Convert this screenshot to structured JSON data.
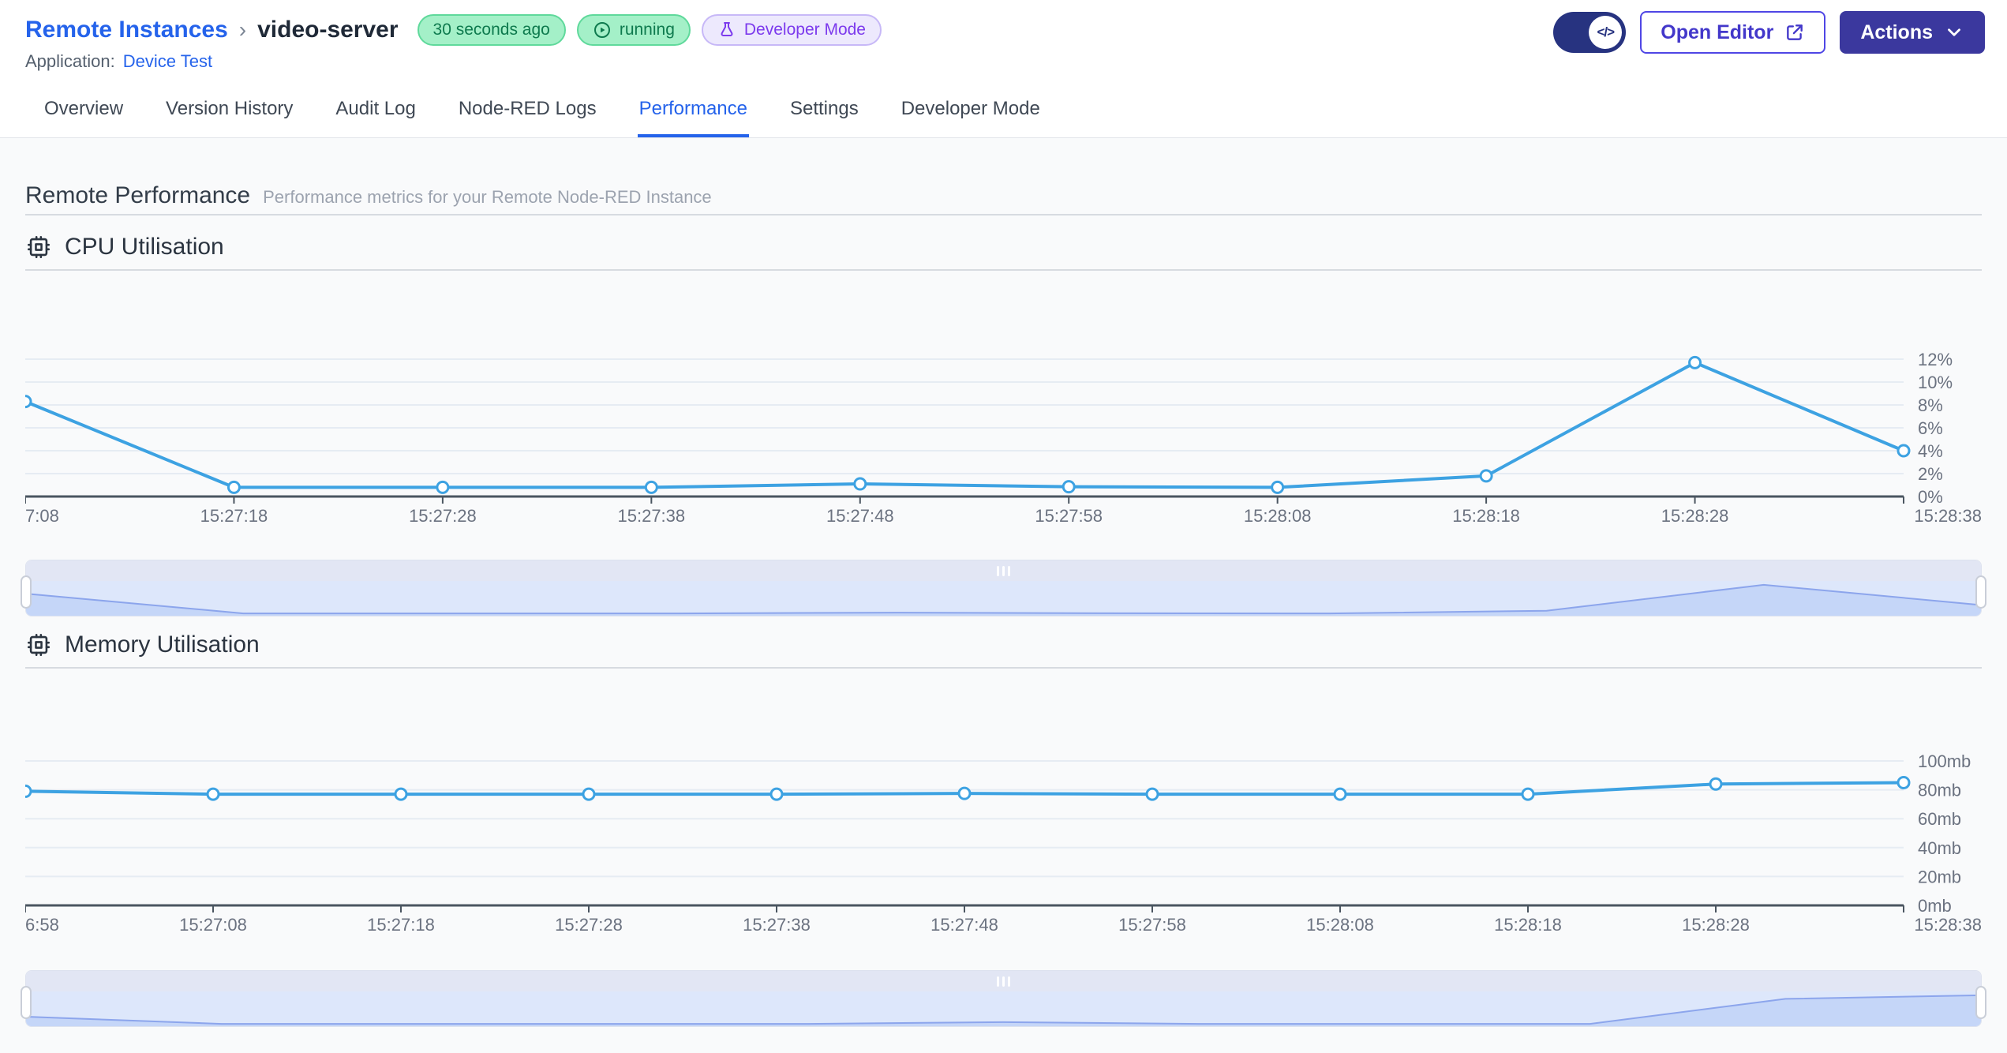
{
  "header": {
    "breadcrumb": {
      "root": "Remote Instances",
      "separator": "›",
      "current": "video-server"
    },
    "badges": [
      {
        "label": "30 seconds ago"
      },
      {
        "label": "running",
        "icon": "play-circle-icon"
      },
      {
        "label": "Developer Mode",
        "icon": "flask-icon"
      }
    ],
    "application_label": "Application:",
    "application_name": "Device Test",
    "toggle_icon_text": "</>",
    "open_editor_label": "Open Editor",
    "actions_label": "Actions"
  },
  "tabs": [
    {
      "label": "Overview",
      "active": false
    },
    {
      "label": "Version History",
      "active": false
    },
    {
      "label": "Audit Log",
      "active": false
    },
    {
      "label": "Node-RED Logs",
      "active": false
    },
    {
      "label": "Performance",
      "active": true
    },
    {
      "label": "Settings",
      "active": false
    },
    {
      "label": "Developer Mode",
      "active": false
    }
  ],
  "page": {
    "title": "Remote Performance",
    "subtitle": "Performance metrics for your Remote Node-RED Instance"
  },
  "colors": {
    "accent": "#2563eb",
    "brand_indigo": "#3b389e",
    "indigo": "#4f46e5",
    "indigo_text": "#4338ca",
    "toggle_navy": "#273380",
    "green_bg": "#a4f0c8",
    "green_border": "#5fd99b",
    "green_text": "#0e7a4e",
    "purple_bg": "#ede9fd",
    "purple_border": "#c7b8f7",
    "purple_text": "#7c3aed",
    "chart_line": "#3da2e2",
    "grid_line": "#e6ecf3",
    "axis_line": "#4a5560",
    "axis_text": "#6b7280",
    "brush_fill": "#c5d6f8",
    "brush_line": "#8ca5ec"
  },
  "chart_data": [
    {
      "id": "cpu",
      "type": "line",
      "title": "CPU Utilisation",
      "icon": "cpu-chip-icon",
      "x": [
        "7:08",
        "15:27:18",
        "15:27:28",
        "15:27:38",
        "15:27:48",
        "15:27:58",
        "15:28:08",
        "15:28:18",
        "15:28:28",
        "15:28:38"
      ],
      "values": [
        8.3,
        0.8,
        0.8,
        0.8,
        1.1,
        0.85,
        0.8,
        1.8,
        11.7,
        4.0
      ],
      "y_ticks": [
        0,
        2,
        4,
        6,
        8,
        10,
        12
      ],
      "y_tick_labels": [
        "0%",
        "2%",
        "4%",
        "6%",
        "8%",
        "10%",
        "12%"
      ],
      "ylim": [
        0,
        12
      ],
      "grid": true,
      "y_axis_side": "right"
    },
    {
      "id": "memory",
      "type": "line",
      "title": "Memory Utilisation",
      "icon": "cpu-chip-icon",
      "x": [
        "6:58",
        "15:27:08",
        "15:27:18",
        "15:27:28",
        "15:27:38",
        "15:27:48",
        "15:27:58",
        "15:28:08",
        "15:28:18",
        "15:28:28",
        "15:28:38"
      ],
      "values": [
        79,
        77,
        77,
        77,
        77,
        77.5,
        77,
        77,
        77,
        84,
        85
      ],
      "y_ticks": [
        0,
        20,
        40,
        60,
        80,
        100
      ],
      "y_tick_labels": [
        "0mb",
        "20mb",
        "40mb",
        "60mb",
        "80mb",
        "100mb"
      ],
      "ylim": [
        0,
        100
      ],
      "grid": true,
      "y_axis_side": "right"
    }
  ]
}
